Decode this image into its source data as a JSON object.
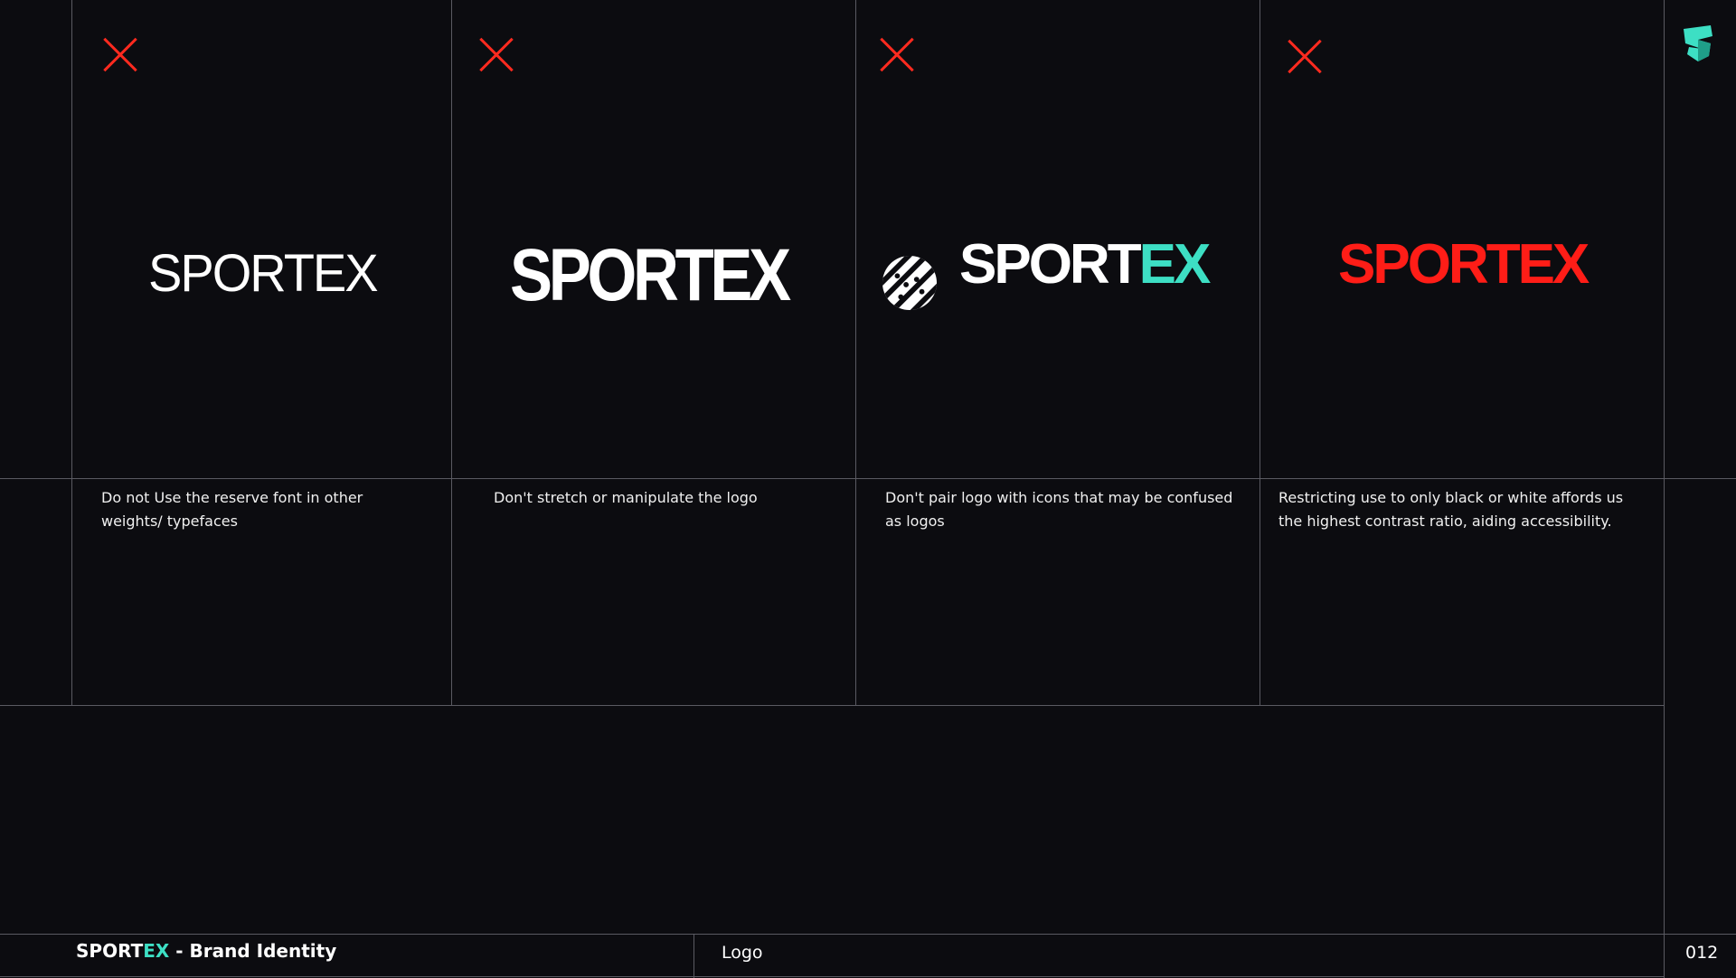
{
  "panels": [
    {
      "logo": "SPORTEX",
      "caption": "Do not Use the reserve font in other weights/ typefaces"
    },
    {
      "logo": "SPORTEX",
      "caption": "Don't stretch or manipulate the logo"
    },
    {
      "logo_main": "SPORT",
      "logo_accent": "EX",
      "caption": "Don't pair logo with icons that may be confused as logos"
    },
    {
      "logo": "SPORTEX",
      "caption": "Restricting use to only black or white affords us the highest contrast ratio, aiding accessibility."
    }
  ],
  "colors": {
    "background": "#0c0c10",
    "grid_line": "#5a5a62",
    "cross": "#ff2a1f",
    "accent": "#3ddfc4",
    "misuse_red": "#ff1d17"
  },
  "icons": {
    "panel_mark": "cross-icon",
    "corner": "brand-shield-icon",
    "paired_icon": "striped-circle-icon"
  },
  "footer": {
    "brand_main": "SPORT",
    "brand_accent": "EX",
    "brand_suffix": " - Brand Identity",
    "section": "Logo",
    "page_number": "012"
  }
}
